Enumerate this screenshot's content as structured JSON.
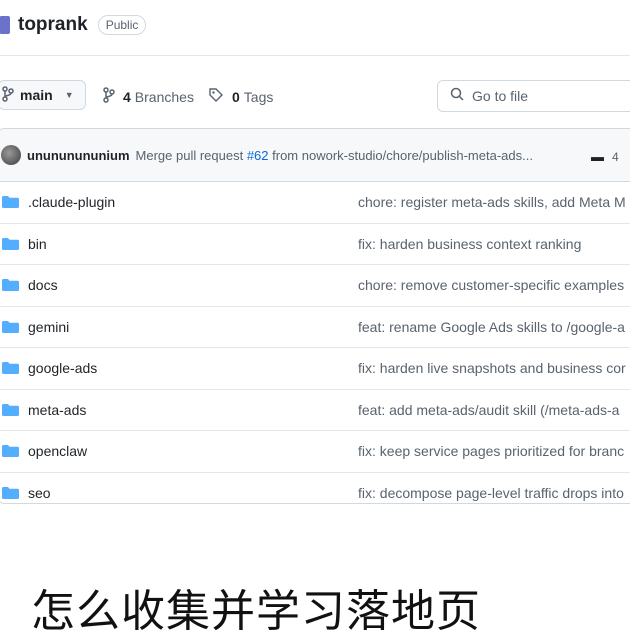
{
  "repo": {
    "name": "toprank",
    "visibility": "Public"
  },
  "toolbar": {
    "branch": "main",
    "branches_count": "4",
    "branches_label": "Branches",
    "tags_count": "0",
    "tags_label": "Tags",
    "search_placeholder": "Go to file"
  },
  "commit": {
    "author": "unununununium",
    "message_prefix": "Merge pull request ",
    "pr": "#62",
    "message_suffix": " from nowork-studio/chore/publish-meta-ads...",
    "extra": "4"
  },
  "files": [
    {
      "name": ".claude-plugin",
      "commit": "chore: register meta-ads skills, add Meta M"
    },
    {
      "name": "bin",
      "commit": "fix: harden business context ranking"
    },
    {
      "name": "docs",
      "commit": "chore: remove customer-specific examples"
    },
    {
      "name": "gemini",
      "commit": "feat: rename Google Ads skills to /google-a"
    },
    {
      "name": "google-ads",
      "commit": "fix: harden live snapshots and business cor"
    },
    {
      "name": "meta-ads",
      "commit": "feat: add meta-ads/audit skill (/meta-ads-a"
    },
    {
      "name": "openclaw",
      "commit": "fix: keep service pages prioritized for branc"
    },
    {
      "name": "seo",
      "commit": "fix: decompose page-level traffic drops into"
    }
  ],
  "caption": "怎么收集并学习落地页",
  "colors": {
    "folder": "#54aeff",
    "link": "#0969da",
    "muted": "#59636e"
  }
}
